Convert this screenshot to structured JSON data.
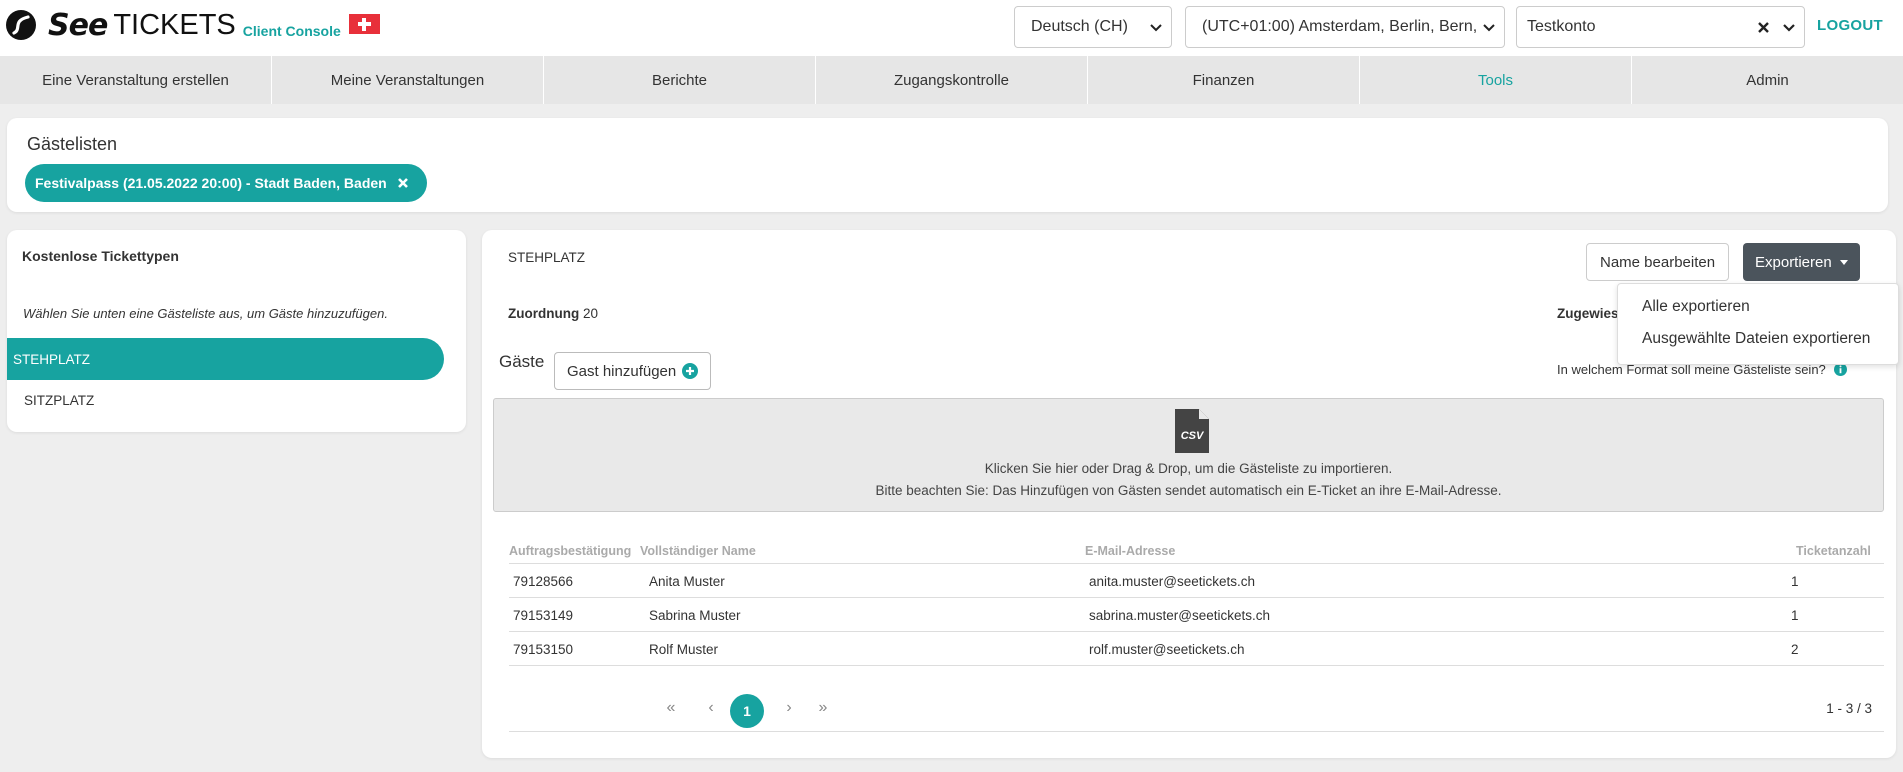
{
  "header": {
    "logo_text_see": "See",
    "logo_text_tickets": "TICKETS",
    "logo_console": "Client Console",
    "language": "Deutsch (CH)",
    "timezone": "(UTC+01:00) Amsterdam, Berlin, Bern,",
    "account": "Testkonto",
    "logout": "LOGOUT"
  },
  "nav": {
    "items": [
      "Eine Veranstaltung erstellen",
      "Meine Veranstaltungen",
      "Berichte",
      "Zugangskontrolle",
      "Finanzen",
      "Tools",
      "Admin"
    ],
    "active": "Tools"
  },
  "guestlists": {
    "title": "Gästelisten",
    "chip": "Festivalpass (21.05.2022 20:00) - Stadt Baden, Baden"
  },
  "left": {
    "title": "Kostenlose Tickettypen",
    "hint": "Wählen Sie unten eine Gästeliste aus, um Gäste hinzuzufügen.",
    "items": [
      "STEHPLATZ",
      "SITZPLATZ"
    ]
  },
  "main": {
    "title": "STEHPLATZ",
    "edit_name": "Name bearbeiten",
    "export": "Exportieren",
    "zuordnung_label": "Zuordnung",
    "zuordnung_value": "20",
    "zugewiesen": "Zugewies",
    "guests_label": "Gäste",
    "add_guest": "Gast hinzufügen",
    "format_question": "In welchem Format soll meine Gästeliste sein?",
    "drop_line1": "Klicken Sie hier oder Drag & Drop, um die Gästeliste zu importieren.",
    "drop_line2": "Bitte beachten Sie: Das Hinzufügen von Gästen sendet automatisch ein E-Ticket an ihre E-Mail-Adresse.",
    "csv_label": "CSV"
  },
  "table": {
    "headers": [
      "Auftragsbestätigung",
      "Vollständiger Name",
      "E-Mail-Adresse",
      "Ticketanzahl"
    ],
    "rows": [
      [
        "79128566",
        "Anita Muster",
        "anita.muster@seetickets.ch",
        "1"
      ],
      [
        "79153149",
        "Sabrina Muster",
        "sabrina.muster@seetickets.ch",
        "1"
      ],
      [
        "79153150",
        "Rolf Muster",
        "rolf.muster@seetickets.ch",
        "2"
      ]
    ]
  },
  "pagination": {
    "current": "1",
    "count": "1 - 3 / 3"
  },
  "export_menu": {
    "items": [
      "Alle exportieren",
      "Ausgewählte Dateien exportieren"
    ]
  },
  "colors": {
    "accent": "#17a3a0",
    "dark_button": "#4b545c",
    "flag_red": "#e8303a"
  }
}
